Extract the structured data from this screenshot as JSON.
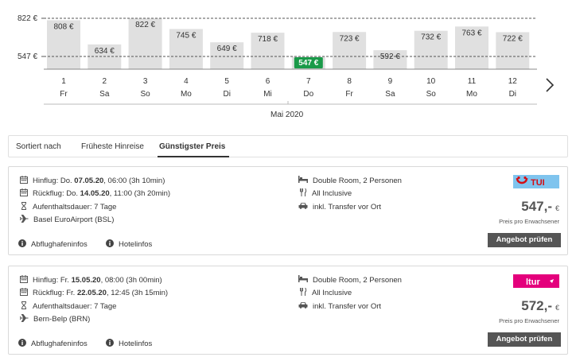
{
  "calendar": {
    "y_labels": [
      "822 €",
      "547 €"
    ],
    "month": "Mai 2020",
    "highlight_color": "#1a9a49",
    "bar_color": "#e0e0e0",
    "days": [
      {
        "day": "1",
        "weekday": "Fr",
        "price": 808,
        "label": "808 €"
      },
      {
        "day": "2",
        "weekday": "Sa",
        "price": 634,
        "label": "634 €"
      },
      {
        "day": "3",
        "weekday": "So",
        "price": 822,
        "label": "822 €"
      },
      {
        "day": "4",
        "weekday": "Mo",
        "price": 745,
        "label": "745 €"
      },
      {
        "day": "5",
        "weekday": "Di",
        "price": 649,
        "label": "649 €"
      },
      {
        "day": "6",
        "weekday": "Mi",
        "price": 718,
        "label": "718 €"
      },
      {
        "day": "7",
        "weekday": "Do",
        "price": 547,
        "label": "547 €",
        "selected": true
      },
      {
        "day": "8",
        "weekday": "Fr",
        "price": 723,
        "label": "723 €"
      },
      {
        "day": "9",
        "weekday": "Sa",
        "price": 592,
        "label": "592 €"
      },
      {
        "day": "10",
        "weekday": "So",
        "price": 732,
        "label": "732 €"
      },
      {
        "day": "11",
        "weekday": "Mo",
        "price": 763,
        "label": "763 €"
      },
      {
        "day": "12",
        "weekday": "Di",
        "price": 722,
        "label": "722 €"
      }
    ],
    "next_icon": "chevron-right-icon"
  },
  "sort": {
    "label": "Sortiert nach",
    "options": [
      "Früheste Hinreise",
      "Günstigster Preis"
    ],
    "active": "Günstigster Preis"
  },
  "offers": [
    {
      "outbound_prefix": "Hinflug: Do. ",
      "outbound_date": "07.05.20",
      "outbound_rest": ", 06:00 (3h 10min)",
      "return_prefix": "Rückflug: Do. ",
      "return_date": "14.05.20",
      "return_rest": ", 11:00 (3h 20min)",
      "stay": "Aufenthaltsdauer: 7 Tage",
      "airport": "Basel EuroAirport (BSL)",
      "room": "Double Room, 2 Personen",
      "board": "All Inclusive",
      "transfer": "inkl. Transfer vor Ort",
      "operator": "TUI",
      "price": "547,-",
      "currency": "€",
      "price_note": "Preis pro Erwachsener",
      "button": "Angebot prüfen",
      "airport_info": "Abflughafeninfos",
      "hotel_info": "Hotelinfos"
    },
    {
      "outbound_prefix": "Hinflug: Fr. ",
      "outbound_date": "15.05.20",
      "outbound_rest": ", 08:00 (3h 00min)",
      "return_prefix": "Rückflug: Fr. ",
      "return_date": "22.05.20",
      "return_rest": ", 12:45 (3h 15min)",
      "stay": "Aufenthaltsdauer: 7 Tage",
      "airport": "Bern-Belp (BRN)",
      "room": "Double Room, 2 Personen",
      "board": "All Inclusive",
      "transfer": "inkl. Transfer vor Ort",
      "operator": "ltur",
      "price": "572,-",
      "currency": "€",
      "price_note": "Preis pro Erwachsener",
      "button": "Angebot prüfen",
      "airport_info": "Abflughafeninfos",
      "hotel_info": "Hotelinfos"
    }
  ],
  "colors": {
    "tui_bg": "#7fc4ee",
    "tui_red": "#d40e14",
    "ltur_pink": "#e4007c",
    "button": "#555555"
  }
}
